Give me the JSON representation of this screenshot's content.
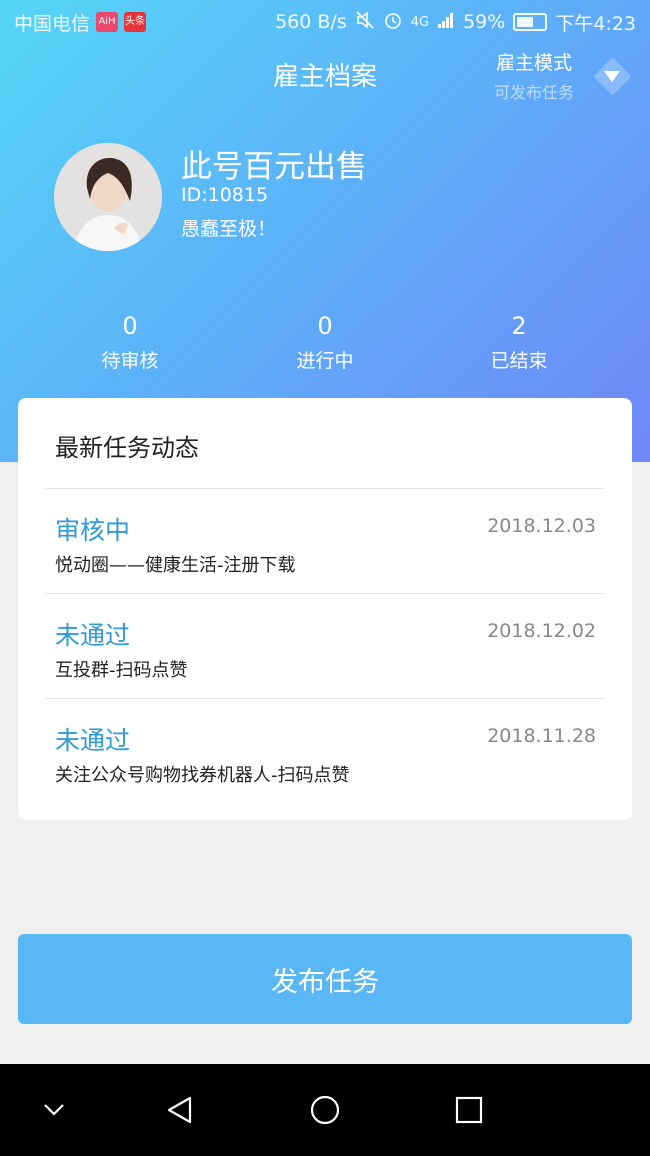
{
  "status_bar": {
    "carrier": "中国电信",
    "badge1": "AiH",
    "badge2": "头条",
    "speed": "560 B/s",
    "network": "4G",
    "battery": "59%",
    "time": "下午4:23"
  },
  "header": {
    "title": "雇主档案",
    "mode_label": "雇主模式",
    "mode_sub": "可发布任务"
  },
  "profile": {
    "name": "此号百元出售",
    "id": "ID:10815",
    "bio": "愚蠢至极！"
  },
  "stats": [
    {
      "value": "0",
      "label": "待审核"
    },
    {
      "value": "0",
      "label": "进行中"
    },
    {
      "value": "2",
      "label": "已结束"
    }
  ],
  "card": {
    "title": "最新任务动态",
    "rows": [
      {
        "status": "审核中",
        "date": "2018.12.03",
        "desc": "悦动圈——健康生活-注册下载"
      },
      {
        "status": "未通过",
        "date": "2018.12.02",
        "desc": "互投群-扫码点赞"
      },
      {
        "status": "未通过",
        "date": "2018.11.28",
        "desc": "关注公众号购物找券机器人-扫码点赞"
      }
    ]
  },
  "publish_button": "发布任务",
  "colors": {
    "gradient_start": "#55d6f7",
    "gradient_end": "#6f86f8",
    "status_text": "#2e9ad9",
    "button": "#5ab7f6"
  },
  "icons": {
    "nav_back": "chevron-down-icon",
    "nav_triangle": "back-triangle-icon",
    "nav_home": "home-circle-icon",
    "nav_recent": "recent-square-icon"
  }
}
